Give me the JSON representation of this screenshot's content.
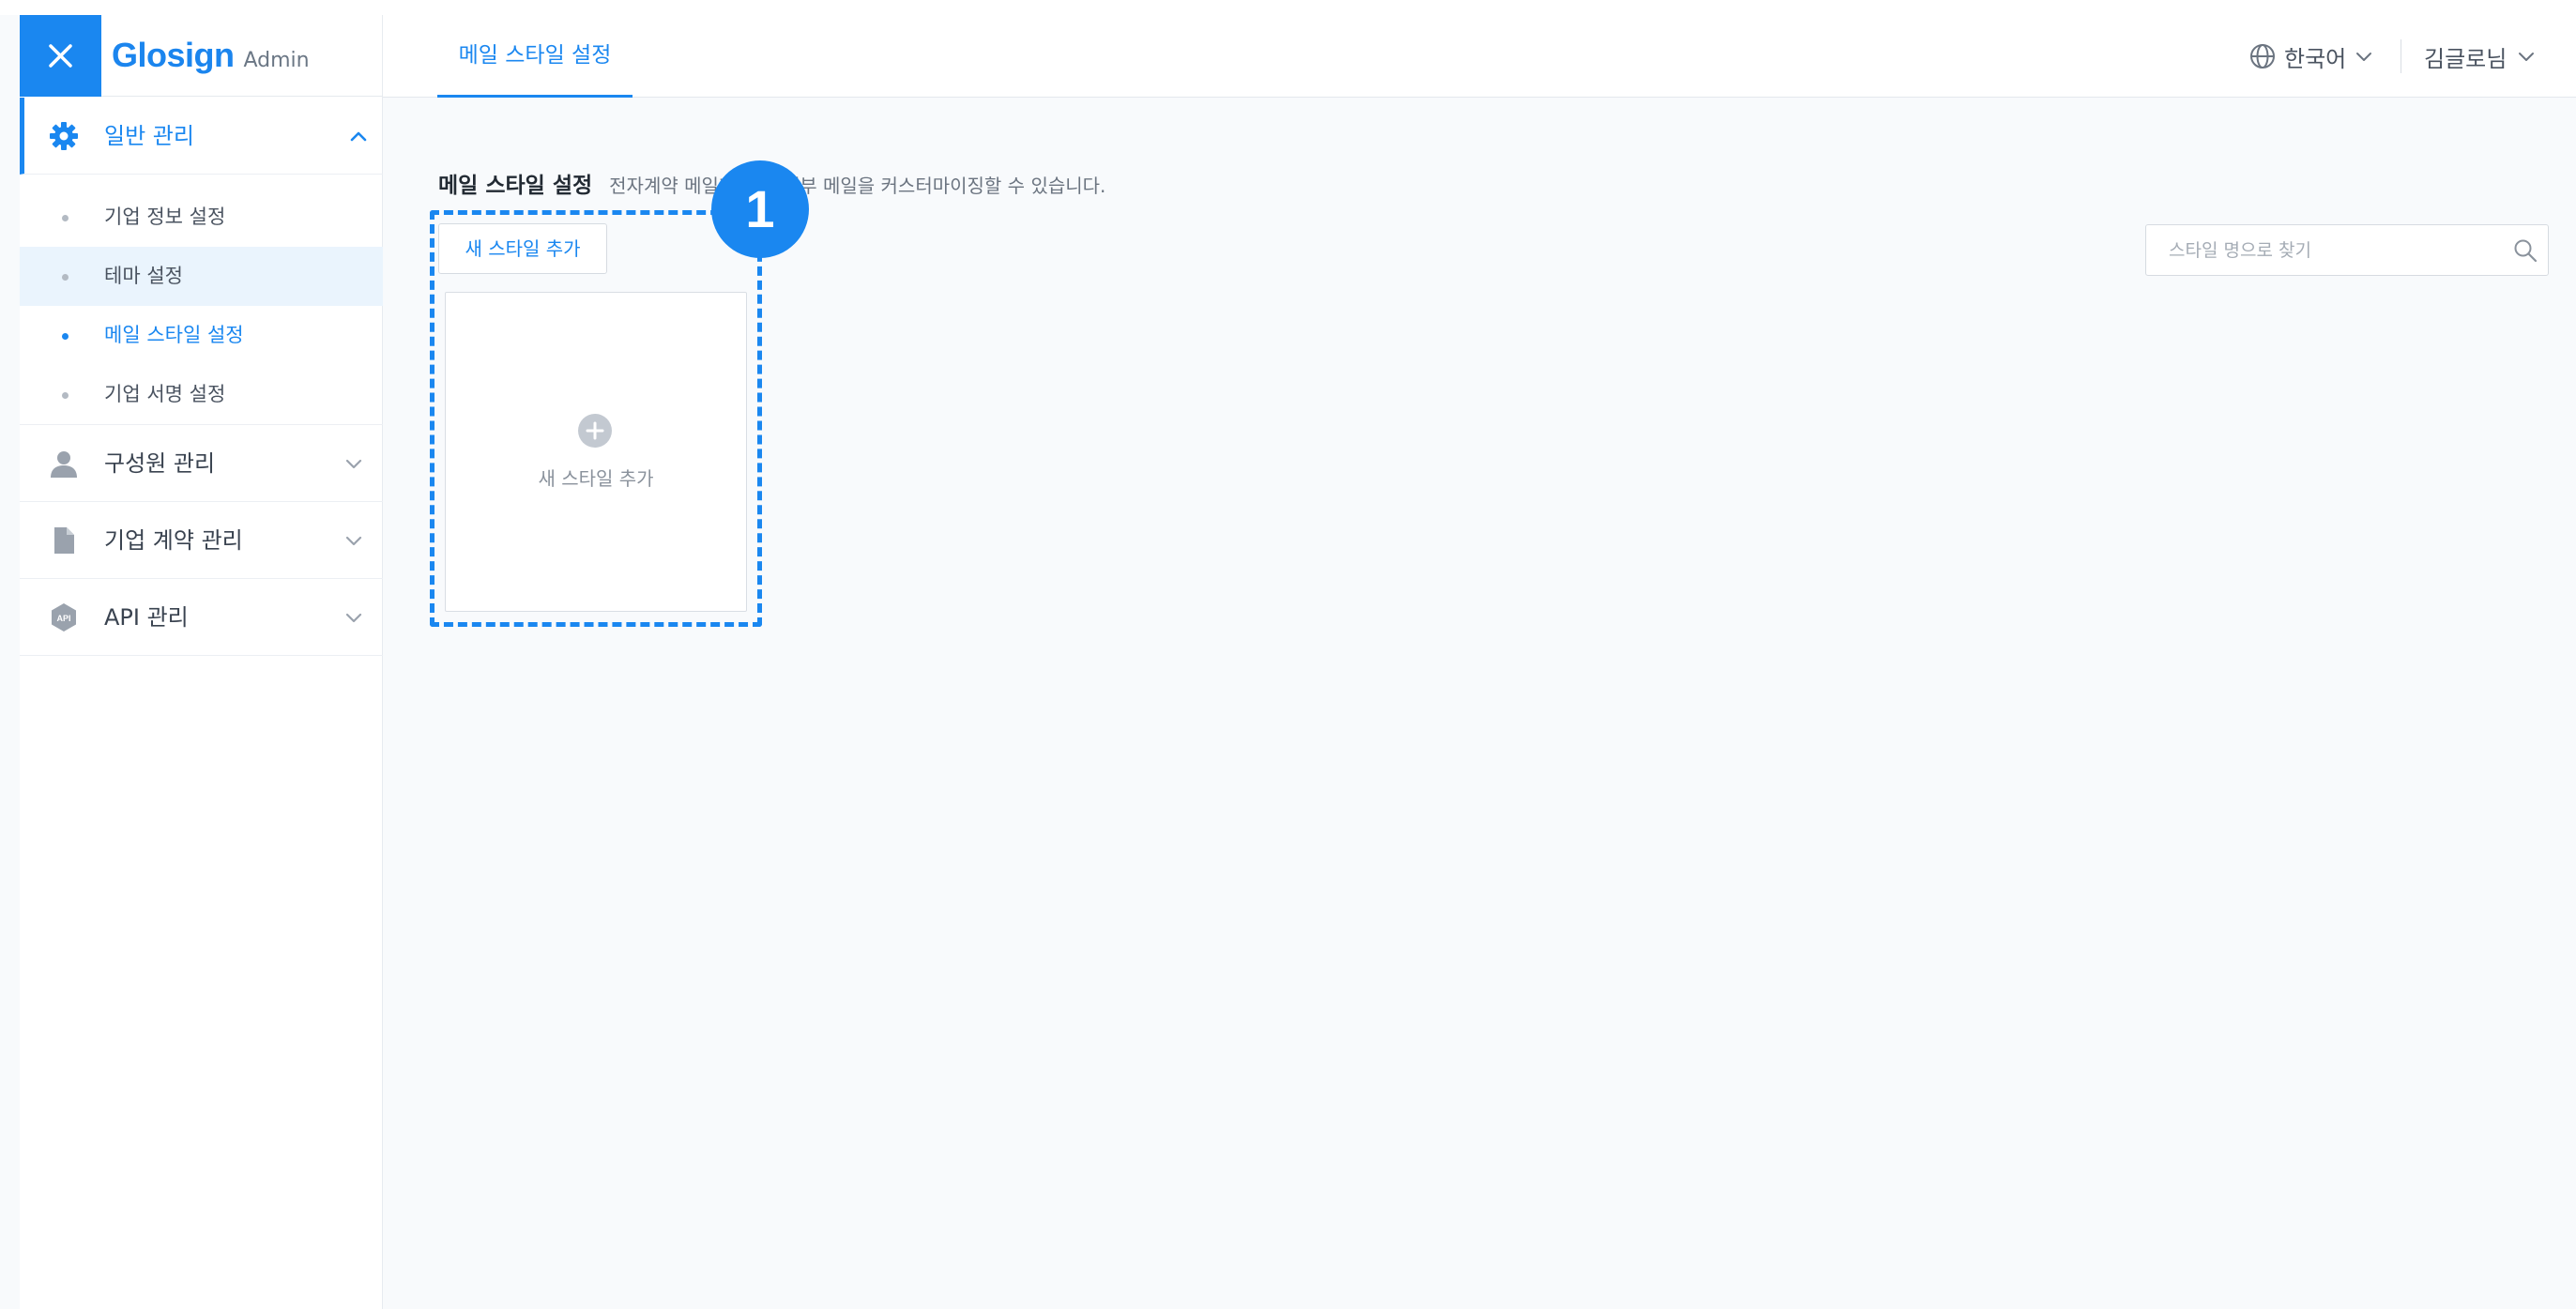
{
  "app": {
    "brand": "Glosign",
    "brand_suffix": "Admin"
  },
  "sidebar": {
    "groups": [
      {
        "label": "일반 관리",
        "icon": "gear-icon",
        "expanded": true,
        "items": [
          {
            "label": "기업 정보 설정"
          },
          {
            "label": "테마 설정"
          },
          {
            "label": "메일 스타일 설정"
          },
          {
            "label": "기업 서명 설정"
          }
        ]
      },
      {
        "label": "구성원 관리",
        "icon": "user-icon"
      },
      {
        "label": "기업 계약 관리",
        "icon": "document-icon"
      },
      {
        "label": "API 관리",
        "icon": "api-icon"
      }
    ]
  },
  "header": {
    "tab_label": "메일 스타일 설정",
    "language": "한국어",
    "user": "김글로님"
  },
  "main": {
    "title": "메일 스타일 설정",
    "description": "전자계약 메일과 회사 내부 메일을 커스터마이징할 수 있습니다.",
    "add_button_label": "새 스타일 추가",
    "add_card_label": "새 스타일 추가",
    "search_placeholder": "스타일 명으로 찾기",
    "search_value": ""
  },
  "annotation": {
    "badge": "1"
  },
  "colors": {
    "accent": "#1a87f0",
    "sidebar_highlight": "#eaf4fd",
    "background": "#f8fafc"
  }
}
